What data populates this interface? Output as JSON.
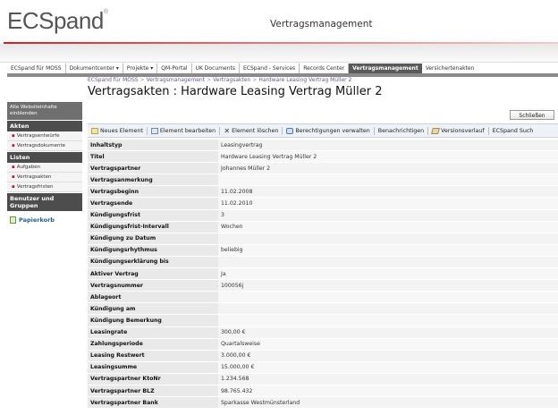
{
  "header": {
    "logo": "ECSpand",
    "logo_mark": "®",
    "site_title": "Vertragsmanagement"
  },
  "topnav": [
    {
      "label": "ECSpand für MOSS"
    },
    {
      "label": "Dokumentcenter ▾"
    },
    {
      "label": "Projekte ▾"
    },
    {
      "label": "QM-Portal"
    },
    {
      "label": "UK Documents"
    },
    {
      "label": "ECSpand - Services"
    },
    {
      "label": "Records Center"
    },
    {
      "label": "Vertragsmanagement",
      "active": true
    },
    {
      "label": "Versichertenakten"
    }
  ],
  "leftnav": {
    "show_content_link": "Alle Websiteinhalte einblenden",
    "sections": [
      {
        "title": "Akten",
        "items": [
          "Vertragsentwürfe",
          "Vertragsdokumente"
        ]
      },
      {
        "title": "Listen",
        "items": [
          "Aufgaben",
          "Vertragsakten",
          "Vertragsfristen"
        ]
      },
      {
        "title": "Benutzer und Gruppen",
        "items": []
      }
    ],
    "recycle_bin": "Papierkorb",
    "accent_color": "#c8102e"
  },
  "breadcrumb": [
    "ECSpand für MOSS",
    "Vertragsmanagement",
    "Vertragsakten",
    "Hardware Leasing Vertrag Müller 2"
  ],
  "page_title": "Vertragsakten : Hardware Leasing Vertrag Müller 2",
  "close_button": "Schließen",
  "toolbar": [
    {
      "label": "Neues Element",
      "icon": "new-item-icon"
    },
    {
      "label": "Element bearbeiten",
      "icon": "edit-icon"
    },
    {
      "label": "Element löschen",
      "icon": "delete-icon"
    },
    {
      "label": "Berechtigungen verwalten",
      "icon": "permissions-icon"
    },
    {
      "label": "Benachrichtigen",
      "icon": ""
    },
    {
      "label": "Versionsverlauf",
      "icon": "version-history-icon"
    },
    {
      "label": "ECSpand Such",
      "icon": ""
    }
  ],
  "properties": [
    {
      "label": "Inhaltstyp",
      "value": "Leasingvertrag"
    },
    {
      "label": "Titel",
      "value": "Hardware Leasing Vertrag Müller 2"
    },
    {
      "label": "Vertragspartner",
      "value": "Johannes Müller 2"
    },
    {
      "label": "Vertragsanmerkung",
      "value": ""
    },
    {
      "label": "Vertragsbeginn",
      "value": "11.02.2008"
    },
    {
      "label": "Vertragsende",
      "value": "11.02.2010"
    },
    {
      "label": "Kündigungsfrist",
      "value": "3"
    },
    {
      "label": "Kündigungsfrist-Intervall",
      "value": "Wochen"
    },
    {
      "label": "Kündigung zu Datum",
      "value": ""
    },
    {
      "label": "Kündigungsrhythmus",
      "value": "beliebig"
    },
    {
      "label": "Kündigungserklärung bis",
      "value": ""
    },
    {
      "label": "Aktiver Vertrag",
      "value": "Ja"
    },
    {
      "label": "Vertragsnummer",
      "value": "100056j"
    },
    {
      "label": "Ablageort",
      "value": ""
    },
    {
      "label": "Kündigung am",
      "value": ""
    },
    {
      "label": "Kündigung Bemerkung",
      "value": ""
    },
    {
      "label": "Leasingrate",
      "value": "300,00 €"
    },
    {
      "label": "Zahlungsperiode",
      "value": "Quartalsweise"
    },
    {
      "label": "Leasing Restwert",
      "value": "3.000,00 €"
    },
    {
      "label": "Leasingsumme",
      "value": "15.000,00 €"
    },
    {
      "label": "Vertragspartner KtoNr",
      "value": "1.234.568"
    },
    {
      "label": "Vertragspartner BLZ",
      "value": "98.765.432"
    },
    {
      "label": "Vertragspartner Bank",
      "value": "Sparkasse Westmünsterland"
    }
  ]
}
